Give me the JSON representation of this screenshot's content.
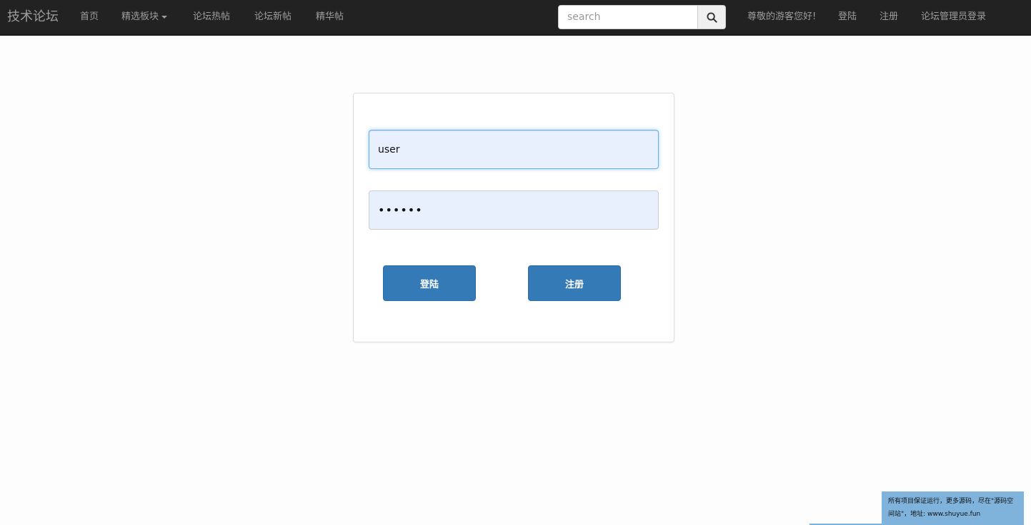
{
  "navbar": {
    "brand": "技术论坛",
    "links": [
      "首页",
      "精选板块",
      "论坛热帖",
      "论坛新帖",
      "精华帖"
    ],
    "search_placeholder": "search",
    "greeting": "尊敬的游客您好!",
    "login": "登陆",
    "register": "注册",
    "admin_login": "论坛管理员登录"
  },
  "form": {
    "username": "user",
    "password": "••••••",
    "login_button": "登陆",
    "register_button": "注册"
  },
  "notice": {
    "text": "所有项目保证运行，更多源码，尽在\"源码空间站\"，地址: www.shuyue.fun"
  },
  "colors": {
    "navbar_bg": "#222222",
    "accent": "#337ab7",
    "input_autofill": "#e8f0fe",
    "notice_bg": "#7fb3dc"
  }
}
